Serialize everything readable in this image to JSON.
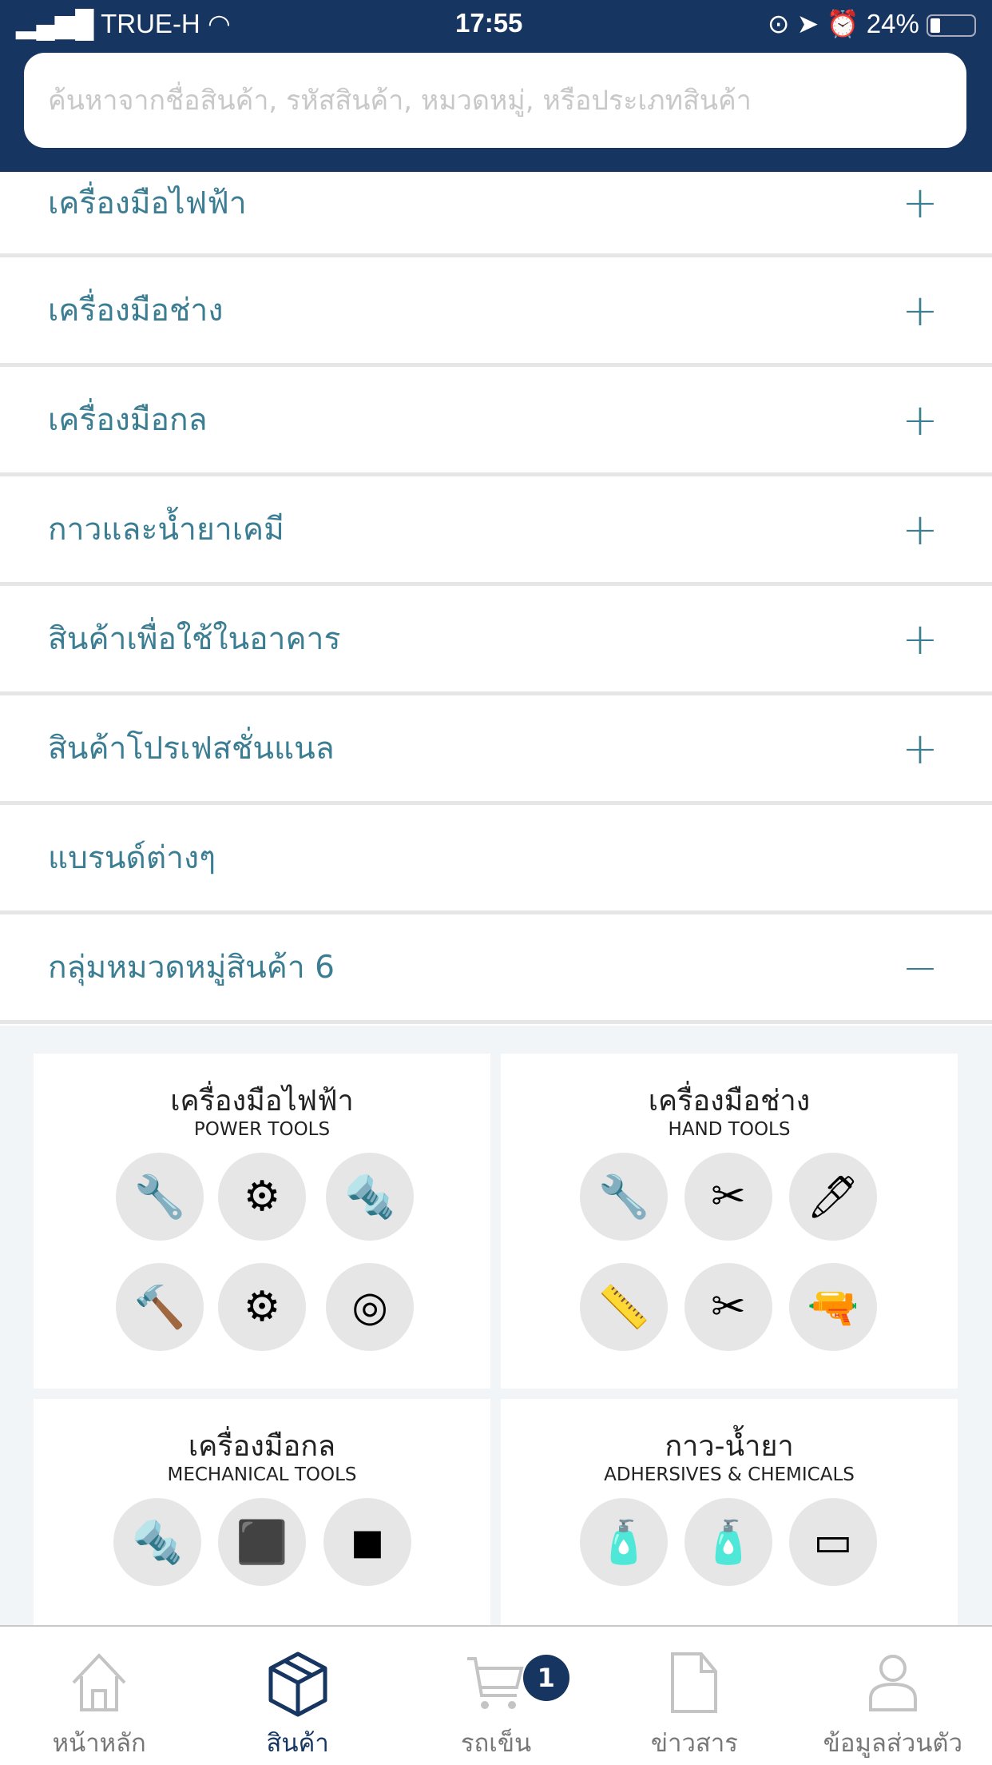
{
  "status_bar": {
    "carrier": "TRUE-H",
    "time": "17:55",
    "battery": "24%"
  },
  "search": {
    "placeholder": "ค้นหาจากชื่อสินค้า, รหัสสินค้า, หมวดหมู่, หรือประเภทสินค้า"
  },
  "categories": [
    {
      "label": "เครื่องมือไฟฟ้า",
      "toggle": "+"
    },
    {
      "label": "เครื่องมือช่าง",
      "toggle": "+"
    },
    {
      "label": "เครื่องมือกล",
      "toggle": "+"
    },
    {
      "label": "กาวและน้ำยาเคมี",
      "toggle": "+"
    },
    {
      "label": "สินค้าเพื่อใช้ในอาคาร",
      "toggle": "+"
    },
    {
      "label": "สินค้าโปรเฟสชั่นแนล",
      "toggle": "+"
    },
    {
      "label": "แบรนด์ต่างๆ",
      "toggle": ""
    },
    {
      "label": "กลุ่มหมวดหมู่สินค้า 6",
      "toggle": "−"
    }
  ],
  "cards": [
    {
      "title": "เครื่องมือไฟฟ้า",
      "subtitle": "POWER TOOLS"
    },
    {
      "title": "เครื่องมือช่าง",
      "subtitle": "HAND TOOLS"
    },
    {
      "title": "เครื่องมือกล",
      "subtitle": "MECHANICAL TOOLS"
    },
    {
      "title": "กาว-น้ำยา",
      "subtitle": "ADHERSIVES & CHEMICALS"
    }
  ],
  "nav": [
    {
      "label": "หน้าหลัก"
    },
    {
      "label": "สินค้า"
    },
    {
      "label": "รถเข็น",
      "badge": "1"
    },
    {
      "label": "ข่าวสาร"
    },
    {
      "label": "ข้อมูลส่วนตัว"
    }
  ],
  "colors": {
    "header": "#163561",
    "accent": "#3b7d92"
  }
}
